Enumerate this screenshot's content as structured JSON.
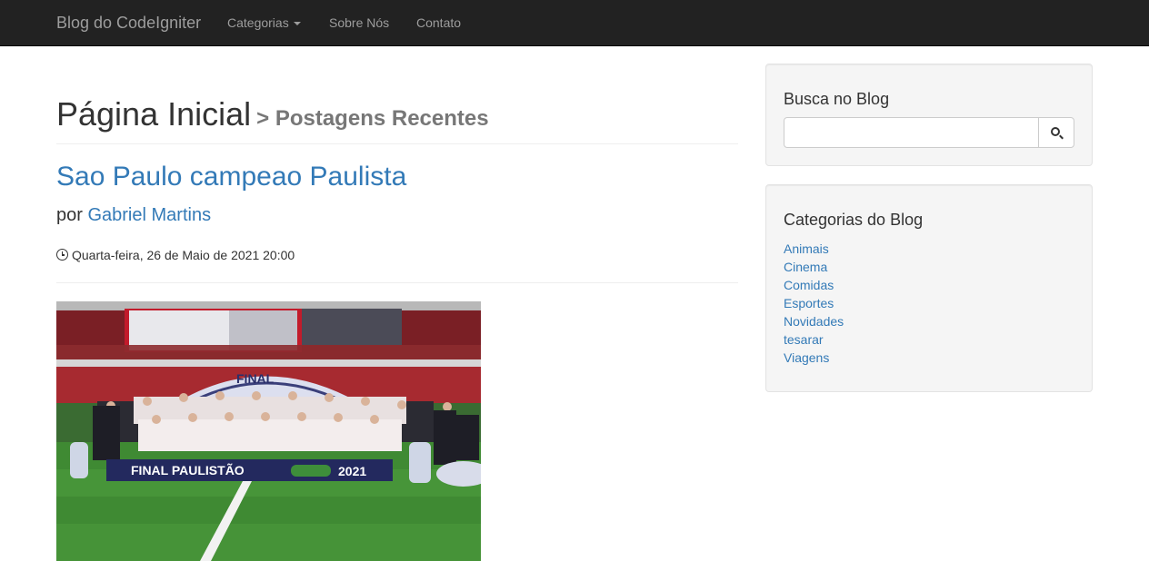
{
  "navbar": {
    "brand": "Blog do CodeIgniter",
    "items": [
      {
        "label": "Categorias",
        "dropdown": true
      },
      {
        "label": "Sobre Nós"
      },
      {
        "label": "Contato"
      }
    ]
  },
  "header": {
    "title": "Página Inicial",
    "subtitle": "> Postagens Recentes"
  },
  "post": {
    "title": "Sao Paulo campeao Paulista",
    "by_prefix": "por",
    "author": "Gabriel Martins",
    "date": "Quarta-feira, 26 de Maio de 2021 20:00",
    "banner_text": "FINAL PAULISTÃO",
    "banner_year": "2021",
    "arch_text": "FINAL"
  },
  "sidebar": {
    "search": {
      "title": "Busca no Blog",
      "placeholder": "",
      "value": ""
    },
    "categories": {
      "title": "Categorias do Blog",
      "items": [
        "Animais",
        "Cinema",
        "Comidas",
        "Esportes",
        "Novidades",
        "tesarar",
        "Viagens"
      ]
    }
  },
  "colors": {
    "link": "#337ab7",
    "navbar": "#222222",
    "well": "#f5f5f5"
  }
}
